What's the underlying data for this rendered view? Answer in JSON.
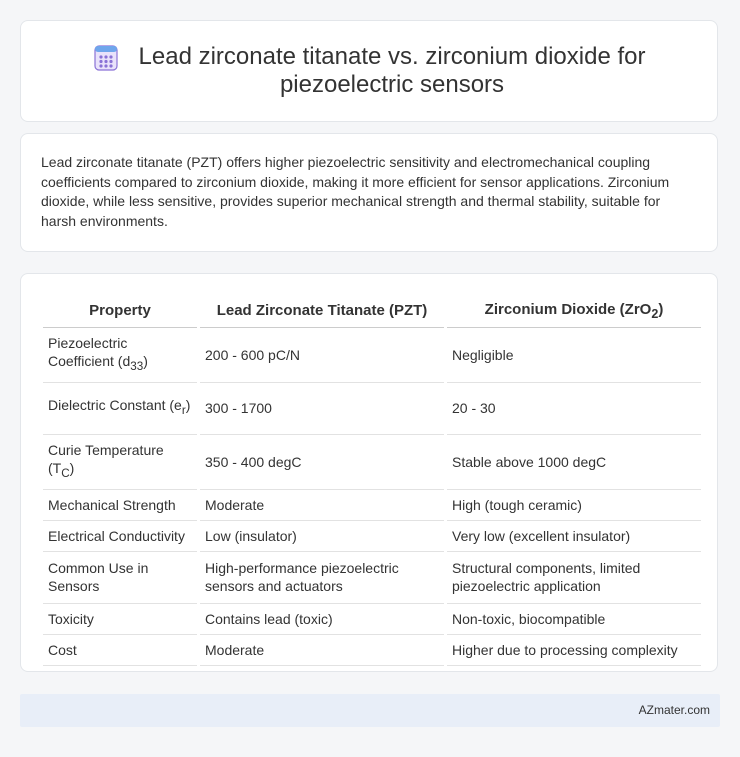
{
  "header": {
    "icon": "calculator-icon",
    "title_line1": "Lead zirconate titanate vs. zirconium dioxide for",
    "title_line2": "piezoelectric sensors"
  },
  "summary": "Lead zirconate titanate (PZT) offers higher piezoelectric sensitivity and electromechanical coupling coefficients compared to zirconium dioxide, making it more efficient for sensor applications. Zirconium dioxide, while less sensitive, provides superior mechanical strength and thermal stability, suitable for harsh environments.",
  "table": {
    "headers": {
      "property": "Property",
      "pzt": "Lead Zirconate Titanate (PZT)",
      "zro2_main": "Zirconium Dioxide (ZrO",
      "zro2_sub": "2",
      "zro2_close": ")"
    },
    "rows": [
      {
        "property": "Piezoelectric Coefficient (d",
        "sub": "33",
        "close": ")",
        "pzt": "200 - 600 pC/N",
        "zro2": "Negligible"
      },
      {
        "property": "Dielectric Constant (e",
        "sub": "r",
        "close": ")",
        "pzt": "300 - 1700",
        "zro2": "20 - 30"
      },
      {
        "property": "Curie Temperature (T",
        "sub": "C",
        "close": ")",
        "pzt": "350 - 400 degC",
        "zro2": "Stable above 1000 degC"
      },
      {
        "property": "Mechanical Strength",
        "pzt": "Moderate",
        "zro2": "High (tough ceramic)"
      },
      {
        "property": "Electrical Conductivity",
        "pzt": "Low (insulator)",
        "zro2": "Very low (excellent insulator)"
      },
      {
        "property": "Common Use in Sensors",
        "pzt": "High-performance piezoelectric sensors and actuators",
        "zro2": "Structural components, limited piezoelectric application"
      },
      {
        "property": "Toxicity",
        "pzt": "Contains lead (toxic)",
        "zro2": "Non-toxic, biocompatible"
      },
      {
        "property": "Cost",
        "pzt": "Moderate",
        "zro2": "Higher due to processing complexity"
      }
    ]
  },
  "footer": {
    "brand": "AZmater.com"
  },
  "colors": {
    "background": "#f5f6f8",
    "footer_bg": "#e8eef8",
    "icon_purple": "#8a72d6",
    "icon_blue": "#6fa6ec"
  }
}
